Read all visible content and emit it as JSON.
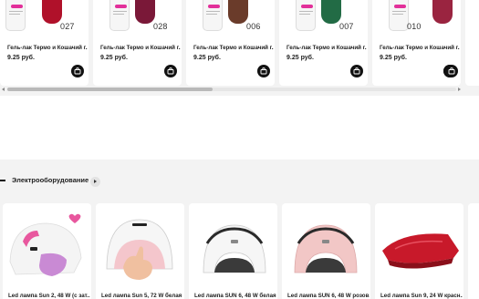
{
  "polish_products": [
    {
      "name": "Гель-лак Термо и Кошачий г...",
      "price": "9.25 руб.",
      "color_number": "027",
      "bottle_color": "#7e1d2a",
      "swatch_color": "#b0112a"
    },
    {
      "name": "Гель-лак Термо и Кошачий г...",
      "price": "9.25 руб.",
      "color_number": "028",
      "bottle_color": "#1f6a3e",
      "swatch_color": "#7a1838"
    },
    {
      "name": "Гель-лак Термо и Кошачий г...",
      "price": "9.25 руб.",
      "color_number": "006",
      "bottle_color": "#4a2a20",
      "swatch_color": "#6a3b2a"
    },
    {
      "name": "Гель-лак Термо и Кошачий г...",
      "price": "9.25 руб.",
      "color_number": "007",
      "bottle_color": "#1d5a3c",
      "swatch_color": "#226b45"
    },
    {
      "name": "Гель-лак Термо и Кошачий г...",
      "price": "9.25 руб.",
      "color_number": "010",
      "bottle_color": "#6a1a2a",
      "swatch_color": "#9a2440"
    }
  ],
  "brand_label_color": "#e2309a",
  "cart_icon": "shopping-bag-icon",
  "section": {
    "title": "Электрооборудование",
    "more_icon": "chevron-right-icon"
  },
  "lamp_products": [
    {
      "name": "Led лампа Sun 2, 48 W (с зат...",
      "lamp_color": "#f2f2f2",
      "accent_color": "#e8579e"
    },
    {
      "name": "Led лампа Sun 5, 72 W белая",
      "lamp_color": "#f4f4f4",
      "accent_color": "#f0c4c8"
    },
    {
      "name": "Led лампа SUN 6, 48 W белая",
      "lamp_color": "#f5f5f5",
      "accent_color": "#2a2a2a"
    },
    {
      "name": "Led лампа SUN 6, 48 W розов...",
      "lamp_color": "#f2c7c6",
      "accent_color": "#2a2a2a"
    },
    {
      "name": "Led лампа Sun 9, 24 W красн...",
      "lamp_color": "#c8192a",
      "accent_color": "#9a0f1c"
    }
  ]
}
